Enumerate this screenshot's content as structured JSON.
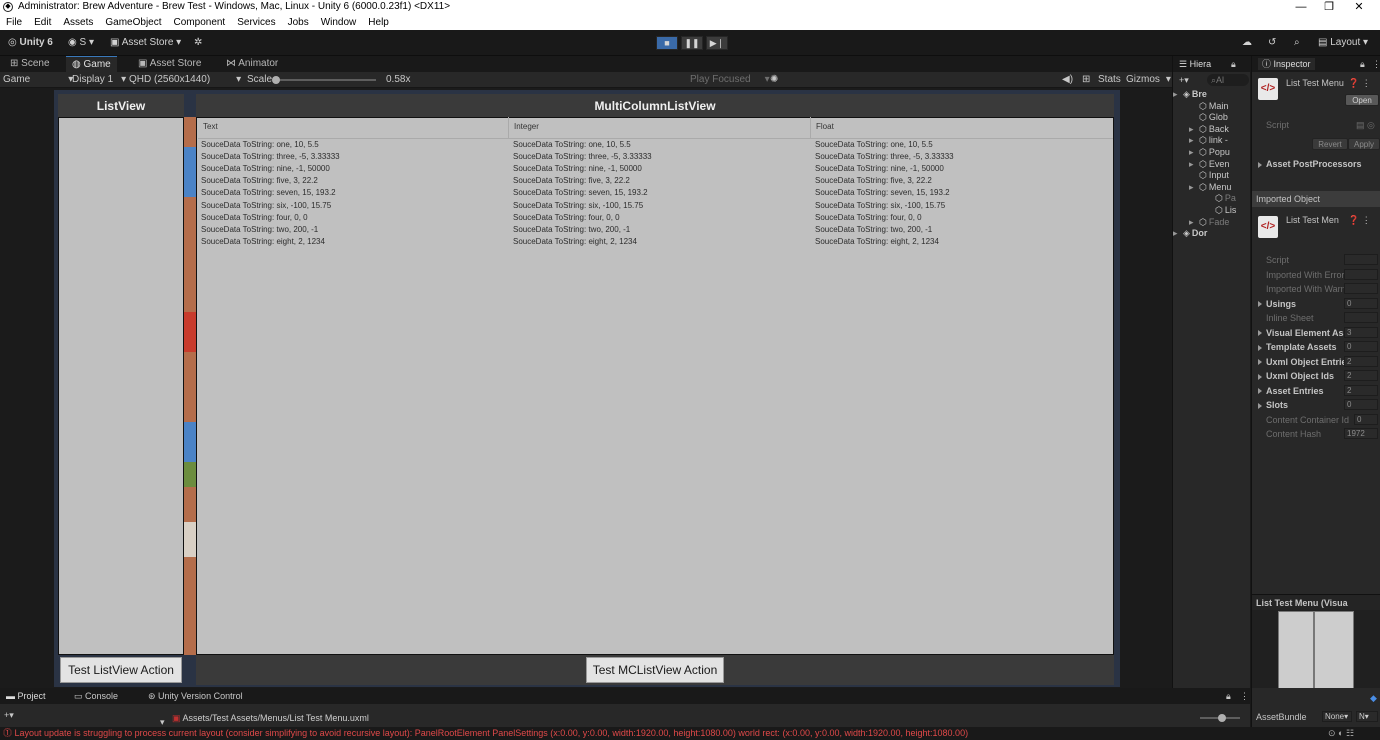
{
  "window": {
    "title": "Administrator: Brew Adventure - Brew Test - Windows, Mac, Linux - Unity 6 (6000.0.23f1) <DX11>",
    "minimize": "—",
    "maximize": "❐",
    "close": "✕"
  },
  "menubar": [
    "File",
    "Edit",
    "Assets",
    "GameObject",
    "Component",
    "Services",
    "Jobs",
    "Window",
    "Help"
  ],
  "toolbar": {
    "unity_label": "Unity 6",
    "account": "S",
    "asset_store": "Asset Store",
    "layout": "Layout"
  },
  "gametabs": [
    "Scene",
    "Game",
    "Asset Store",
    "Animator"
  ],
  "gamebar": {
    "mode": "Game",
    "display": "Display 1",
    "resolution": "QHD (2560x1440)",
    "scale_label": "Scale",
    "scale_value": "0.58x",
    "play_focused": "Play Focused",
    "stats": "Stats",
    "gizmos": "Gizmos"
  },
  "listview": {
    "title": "ListView",
    "action": "Test ListView Action"
  },
  "mclistview": {
    "title": "MultiColumnListView",
    "action": "Test MCListView Action",
    "columns": [
      "Text",
      "Integer",
      "Float"
    ],
    "rows": [
      "SouceData ToString: one, 10, 5.5",
      "SouceData ToString: three, -5, 3.33333",
      "SouceData ToString: nine, -1, 50000",
      "SouceData ToString: five, 3, 22.2",
      "SouceData ToString: seven, 15, 193.2",
      "SouceData ToString: six, -100, 15.75",
      "SouceData ToString: four, 0, 0",
      "SouceData ToString: two, 200, -1",
      "SouceData ToString: eight, 2, 1234"
    ]
  },
  "hierarchy": {
    "tab": "Hiera",
    "search": "Al",
    "items": [
      "Bre",
      "Main",
      "Glob",
      "Back",
      "link -",
      "Popu",
      "Even",
      "Input",
      "Menu",
      "Pa",
      "Lis",
      "Fade",
      "Dor"
    ]
  },
  "inspector": {
    "tab": "Inspector",
    "asset_title": "List Test Menu",
    "open": "Open",
    "script": "Script",
    "revert": "Revert",
    "apply": "Apply",
    "postprocessors": "Asset PostProcessors",
    "imported_object": "Imported Object",
    "imported_title": "List Test Men",
    "fields": [
      {
        "label": "Script",
        "value": "",
        "dim": true
      },
      {
        "label": "Imported With Errors",
        "value": "",
        "dim": true
      },
      {
        "label": "Imported With Warni",
        "value": "",
        "dim": true
      },
      {
        "label": "Usings",
        "value": "0",
        "bold": true
      },
      {
        "label": "Inline Sheet",
        "value": "",
        "dim": true
      },
      {
        "label": "Visual Element Assets",
        "value": "3",
        "bold": true
      },
      {
        "label": "Template Assets",
        "value": "0",
        "bold": true
      },
      {
        "label": "Uxml Object Entrie",
        "value": "2",
        "bold": true
      },
      {
        "label": "Uxml Object Ids",
        "value": "2",
        "bold": true
      },
      {
        "label": "Asset Entries",
        "value": "2",
        "bold": true
      },
      {
        "label": "Slots",
        "value": "0",
        "bold": true
      },
      {
        "label": "Content Container Id",
        "value": "0",
        "dim": true
      },
      {
        "label": "Content Hash",
        "value": "1972",
        "dim": true
      }
    ],
    "preview_title": "List Test Menu (Visua",
    "assetbundle": "AssetBundle",
    "assetbundle_value": "None",
    "variant_value": "N"
  },
  "bottom": {
    "tabs": [
      "Project",
      "Console",
      "Unity Version Control"
    ],
    "path": "Assets/Test Assets/Menus/List Test Menu.uxml",
    "status": "Layout update is struggling to process current layout (consider simplifying to avoid recursive layout): PanelRootElement PanelSettings (x:0.00, y:0.00, width:1920.00, height:1080.00) world rect: (x:0.00, y:0.00, width:1920.00, height:1080.00)"
  }
}
